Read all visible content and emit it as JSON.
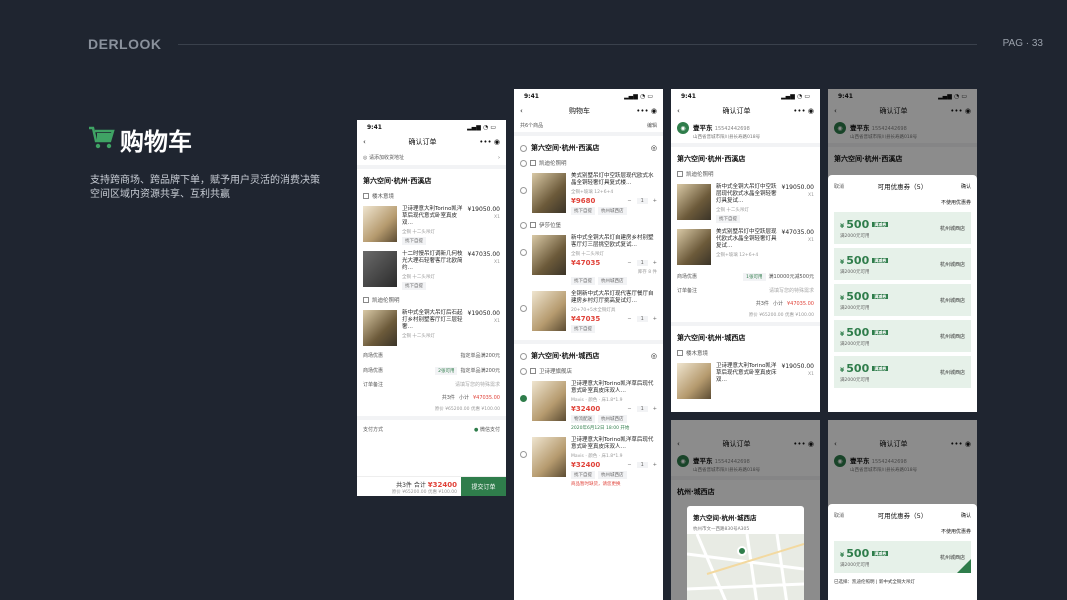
{
  "header": {
    "brand": "DERLOOK",
    "page": "PAG · 33"
  },
  "section": {
    "title": "购物车",
    "desc1": "支持跨商场、跨品牌下单，赋予用户灵活的消费决策",
    "desc2": "空间区域内资源共享、互利共赢"
  },
  "colors": {
    "bg": "#1f2530",
    "accent": "#2f7d4b",
    "price_red": "#e0433a"
  },
  "phone1": {
    "time": "9:41",
    "nav_title": "确认订单",
    "addr_placeholder": "请添加收货地址",
    "store": "第六空间·杭州·西溪店",
    "brand1": "楼木意境",
    "item1": {
      "name": "卫诗理意大利Torino凯洋草后现代意式卧室真皮双…",
      "meta": "全铜 十二头吊灯",
      "price": "¥19050.00",
      "qty": "X1",
      "tag": "找下自提"
    },
    "item2": {
      "name": "十二时慢吊灯调新几何枝光大理石轻奢客厅北欧简约…",
      "meta": "全铜 十二头吊灯",
      "price": "¥47035.00",
      "qty": "X1",
      "tag": "找下自提"
    },
    "brand2": "凯迪伦照明",
    "item3": {
      "name": "新中式全铜大吊灯后石起打乡村别墅客厅灯三层轻奢…",
      "meta": "全铜 十二头吊灯",
      "price": "¥19050.00",
      "qty": "X1"
    },
    "delivery_label": "商场优惠",
    "delivery_value": "物流配送",
    "promo1": "指定单品满200元",
    "promo_label": "商场优惠",
    "promo_tag": "2张可用",
    "promo_value": "指定单品满200元",
    "note_label": "订单备注",
    "note_value": "请填写您的特殊需求",
    "subtotal_count": "共3件",
    "subtotal_label": "小计",
    "subtotal_value": "¥47035.00",
    "discount_line": "原价 ¥65200.00  优惠 ¥100.00",
    "pay_label": "支付方式",
    "pay_value": "微信支付",
    "bottom_count": "共3件",
    "bottom_total_label": "合计",
    "bottom_total": "¥32400",
    "bottom_sub": "原价 ¥65200.00  优惠 ¥100.00",
    "submit": "提交订单"
  },
  "phone2": {
    "time": "9:41",
    "nav_title": "购物车",
    "count": "共6个商品",
    "edit": "编辑",
    "store1": "第六空间·杭州·西溪店",
    "brand1": "凯迪伦照明",
    "item1": {
      "name": "美式别墅吊灯中空跃层现代欧式水晶全铜轻奢灯具复式楼…",
      "meta": "全铜+玻璃 12+6+4",
      "price": "¥9680",
      "tag1": "找下自提",
      "tag2": "杭州城西店"
    },
    "brand2": "伊莎位堡",
    "item2": {
      "name": "新中式全铜大吊灯自建房乡村别墅客厅灯三层挑空欧式复试…",
      "meta": "全铜 十二头吊灯",
      "price": "¥47035",
      "note": "库存 8 件",
      "tag1": "找下自提",
      "tag2": "杭州城西店"
    },
    "item3": {
      "name": "全铜新中式大吊灯现代客厅餐厅自建房乡村灯厅挑高复试灯…",
      "meta": "20+70+5水全铜灯具",
      "price": "¥47035",
      "tag1": "找下自提"
    },
    "store2": "第六空间·杭州·城西店",
    "brand3": "卫诗理旗舰店",
    "item4": {
      "name": "卫诗理意大利Torino凯洋草后现代意式卧室真皮床双人…",
      "meta": "Mavis · 颜色 · 床1.8*1.9",
      "price": "¥32400",
      "tag1": "物流配送",
      "tag2": "杭州城西店",
      "note": "2020年6月12日 18:00 开始"
    },
    "item5": {
      "name": "卫诗理意大利Torino凯洋草后现代意式卧室真皮床双人…",
      "meta": "Mavis · 颜色 · 床1.8*1.9",
      "price": "¥32400",
      "tag1": "找下自提",
      "tag2": "杭州城西店",
      "note": "商品暂时缺货，请您更换"
    }
  },
  "phone3": {
    "time": "9:41",
    "nav_title": "确认订单",
    "name": "壹平东",
    "phone": "15542442698",
    "address": "山西省晋城市阳川县长寿路018号",
    "store": "第六空间·杭州·西溪店",
    "brand": "凯迪伦照明",
    "item1": {
      "name": "新中式全铜大吊灯中空跃层现代欧式水晶全铜轻奢灯具复试…",
      "meta": "全铜 十二头吊灯",
      "price": "¥19050.00",
      "qty": "X1",
      "tag": "找下自提"
    },
    "item2": {
      "name": "美式别墅吊灯中空跃层现代欧式水晶全铜轻奢灯具复试…",
      "meta": "全铜+玻璃 12+6+4",
      "price": "¥47035.00",
      "qty": "X1"
    },
    "promo_label": "商场优惠",
    "promo_tag": "1张可用",
    "promo_value": "满10000元减500元",
    "note_label": "订单备注",
    "note_value": "请填写您的特殊需求",
    "subtotal_count": "共3件",
    "subtotal_label": "小计",
    "subtotal_value": "¥47035.00",
    "discount_line": "原价 ¥65200.00  优惠 ¥100.00",
    "store2": "第六空间·杭州·城西店",
    "brand2": "楼木意境",
    "item3": {
      "name": "卫诗理意大利Torino凯洋草后现代意式卧室真皮床双…",
      "price": "¥19050.00",
      "qty": "X1"
    }
  },
  "phone4": {
    "time": "9:41",
    "nav_title": "确认订单",
    "name": "壹平东",
    "phone": "15542442698",
    "address": "山西省晋城市阳川县长寿路018号",
    "store": "第六空间·杭州·西溪店",
    "cancel": "取消",
    "sheet_title": "可用优惠券（5）",
    "confirm": "确认",
    "no_coupon": "不使用优惠券",
    "coupons": [
      {
        "value": "500",
        "badge": "满减券",
        "min": "满2000元可用",
        "store": "杭州城西店"
      },
      {
        "value": "500",
        "badge": "满减券",
        "min": "满2000元可用",
        "store": "杭州城西店"
      },
      {
        "value": "500",
        "badge": "满减券",
        "min": "满2000元可用",
        "store": "杭州城西店"
      },
      {
        "value": "500",
        "badge": "满减券",
        "min": "满2000元可用",
        "store": "杭州城西店"
      },
      {
        "value": "500",
        "badge": "满减券",
        "min": "满2000元可用",
        "store": "杭州城西店"
      }
    ]
  },
  "phone5": {
    "nav_title": "确认订单",
    "name": "壹平东",
    "phone": "15542442698",
    "address": "山西省晋城市阳川县长寿路018号",
    "store_bg": "杭州·城西店",
    "popup_store": "第六空间·杭州·城西店",
    "popup_addr": "杭州市文一西路830号A305"
  },
  "phone6": {
    "nav_title": "确认订单",
    "name": "壹平东",
    "phone": "15542442698",
    "address": "山西省晋城市阳川县长寿路018号",
    "cancel": "取消",
    "sheet_title": "可用优惠券（5）",
    "confirm": "确认",
    "no_coupon": "不使用优惠券",
    "coupon": {
      "value": "500",
      "badge": "满减券",
      "min": "满2000元可用",
      "store": "杭州城西店"
    },
    "selected": "已选择：凯迪伦照明 | 新中式全铜大吊灯"
  }
}
